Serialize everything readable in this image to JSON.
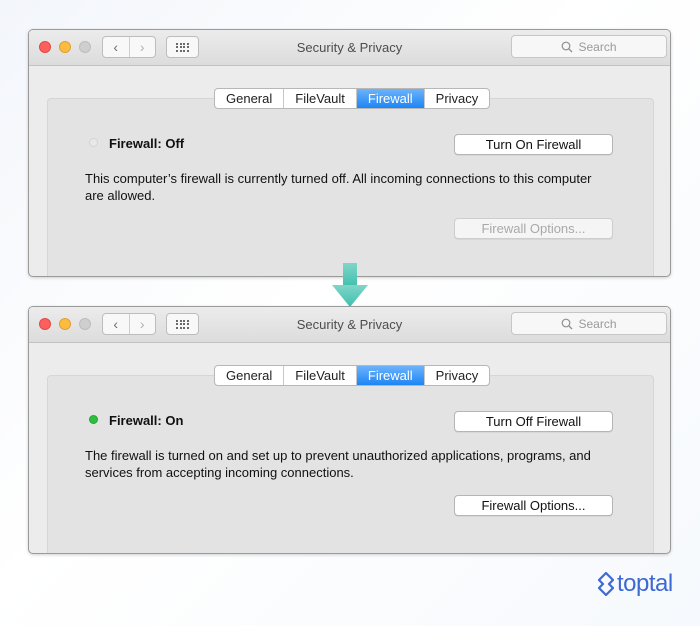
{
  "windows": [
    {
      "title": "Security & Privacy",
      "search_placeholder": "Search",
      "tabs": [
        "General",
        "FileVault",
        "Firewall",
        "Privacy"
      ],
      "active_tab": "Firewall",
      "status_label": "Firewall: Off",
      "status_state": "off",
      "toggle_button": "Turn On Firewall",
      "description": "This computer’s firewall is currently turned off. All incoming connections to this computer are allowed.",
      "options_button": "Firewall Options...",
      "options_enabled": false
    },
    {
      "title": "Security & Privacy",
      "search_placeholder": "Search",
      "tabs": [
        "General",
        "FileVault",
        "Firewall",
        "Privacy"
      ],
      "active_tab": "Firewall",
      "status_label": "Firewall: On",
      "status_state": "on",
      "toggle_button": "Turn Off Firewall",
      "description": "The firewall is turned on and set up to prevent unauthorized applications, programs, and services from accepting incoming connections.",
      "options_button": "Firewall Options...",
      "options_enabled": true
    }
  ],
  "nav": {
    "back_icon": "chevron-left-icon",
    "forward_icon": "chevron-right-icon",
    "grid_icon": "grid-icon"
  },
  "arrow_icon": "down-arrow-icon",
  "colors": {
    "status_on": "#2fbd3f",
    "tab_active": "#1d85f5",
    "arrow": "#4fc6b4",
    "logo": "#3d6ad1"
  },
  "logo": {
    "text": "toptal"
  }
}
